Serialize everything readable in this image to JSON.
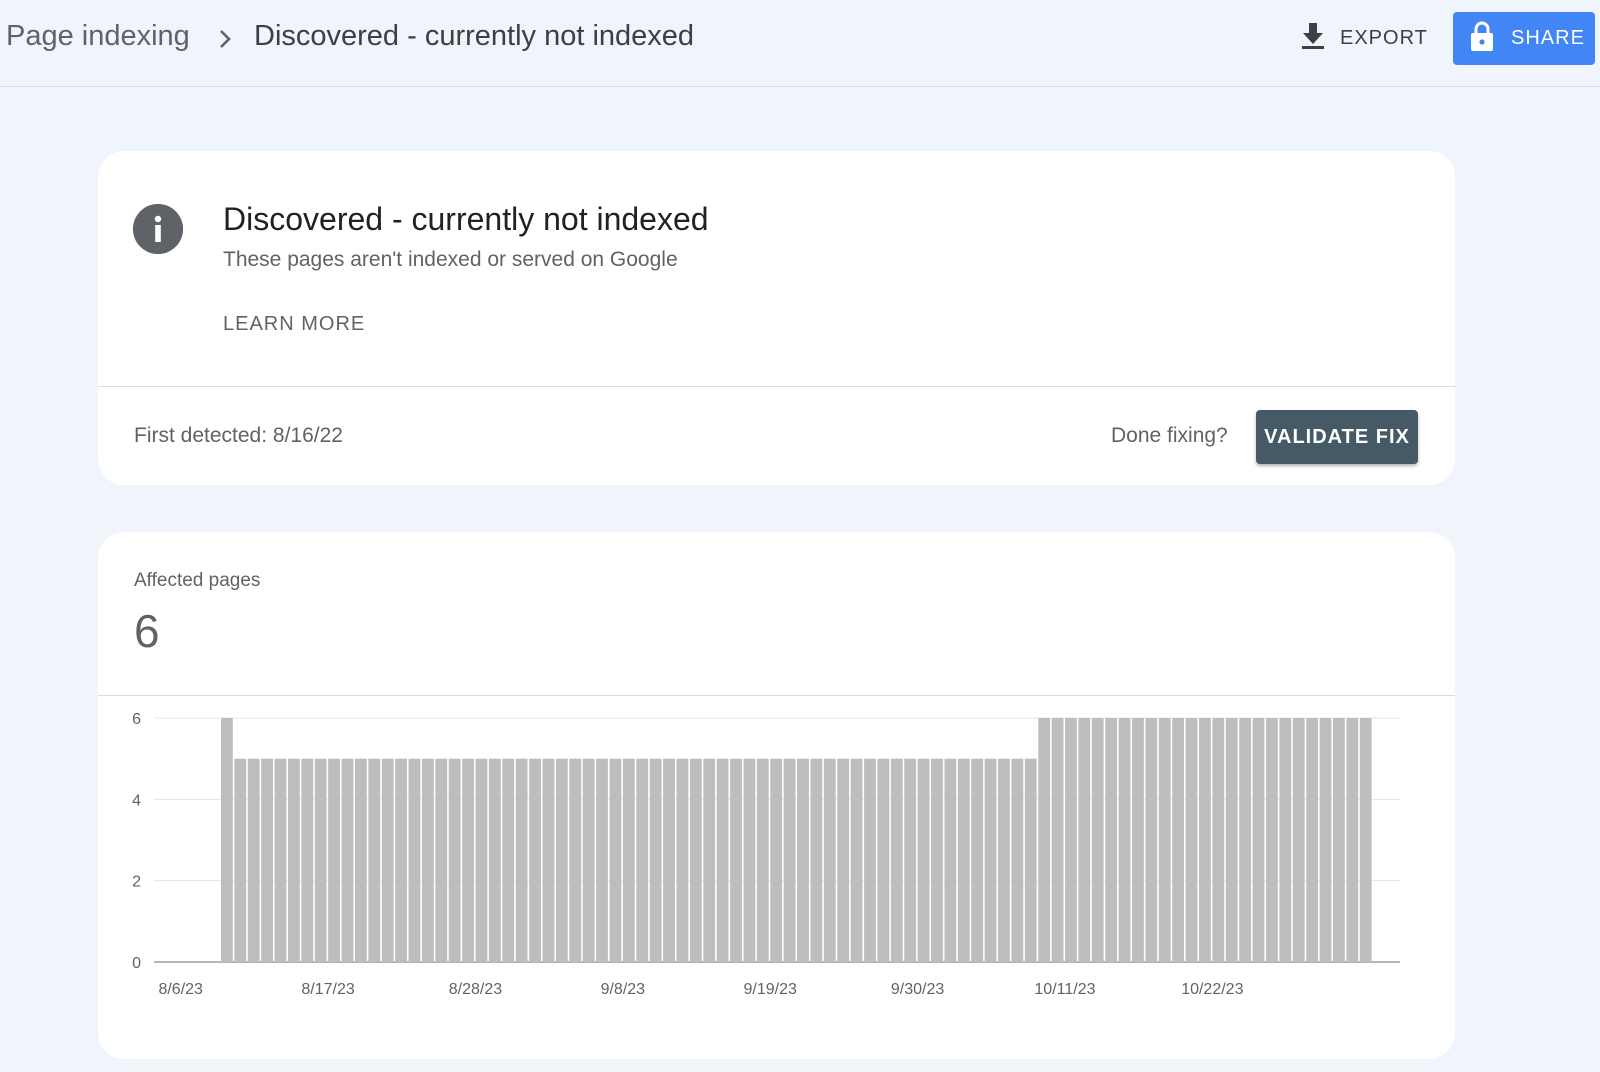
{
  "header": {
    "breadcrumb_root": "Page indexing",
    "breadcrumb_current": "Discovered - currently not indexed",
    "export_label": "EXPORT",
    "share_label": "SHARE",
    "share_color": "#4285f4"
  },
  "info_card": {
    "title": "Discovered - currently not indexed",
    "subtitle": "These pages aren't indexed or served on Google",
    "learn_more": "LEARN MORE",
    "first_detected": "First detected: 8/16/22",
    "done_fixing": "Done fixing?",
    "validate_fix": "VALIDATE FIX"
  },
  "affected": {
    "label": "Affected pages",
    "value": "6"
  },
  "chart_data": {
    "type": "bar",
    "bar_color": "#bdbdbd",
    "ylim": [
      0,
      6
    ],
    "yticks": [
      0,
      2,
      4,
      6
    ],
    "x_tick_labels": [
      "8/6/23",
      "8/17/23",
      "8/28/23",
      "9/8/23",
      "9/19/23",
      "9/30/23",
      "10/11/23",
      "10/22/23"
    ],
    "start_date": "8/6/23",
    "series": [
      {
        "values": [
          0,
          0,
          0,
          0,
          0,
          6,
          5,
          5,
          5,
          5,
          5,
          5,
          5,
          5,
          5,
          5,
          5,
          5,
          5,
          5,
          5,
          5,
          5,
          5,
          5,
          5,
          5,
          5,
          5,
          5,
          5,
          5,
          5,
          5,
          5,
          5,
          5,
          5,
          5,
          5,
          5,
          5,
          5,
          5,
          5,
          5,
          5,
          5,
          5,
          5,
          5,
          5,
          5,
          5,
          5,
          5,
          5,
          5,
          5,
          5,
          5,
          5,
          5,
          5,
          5,
          5,
          6,
          6,
          6,
          6,
          6,
          6,
          6,
          6,
          6,
          6,
          6,
          6,
          6,
          6,
          6,
          6,
          6,
          6,
          6,
          6,
          6,
          6,
          6,
          6,
          6,
          0,
          0
        ]
      }
    ]
  }
}
